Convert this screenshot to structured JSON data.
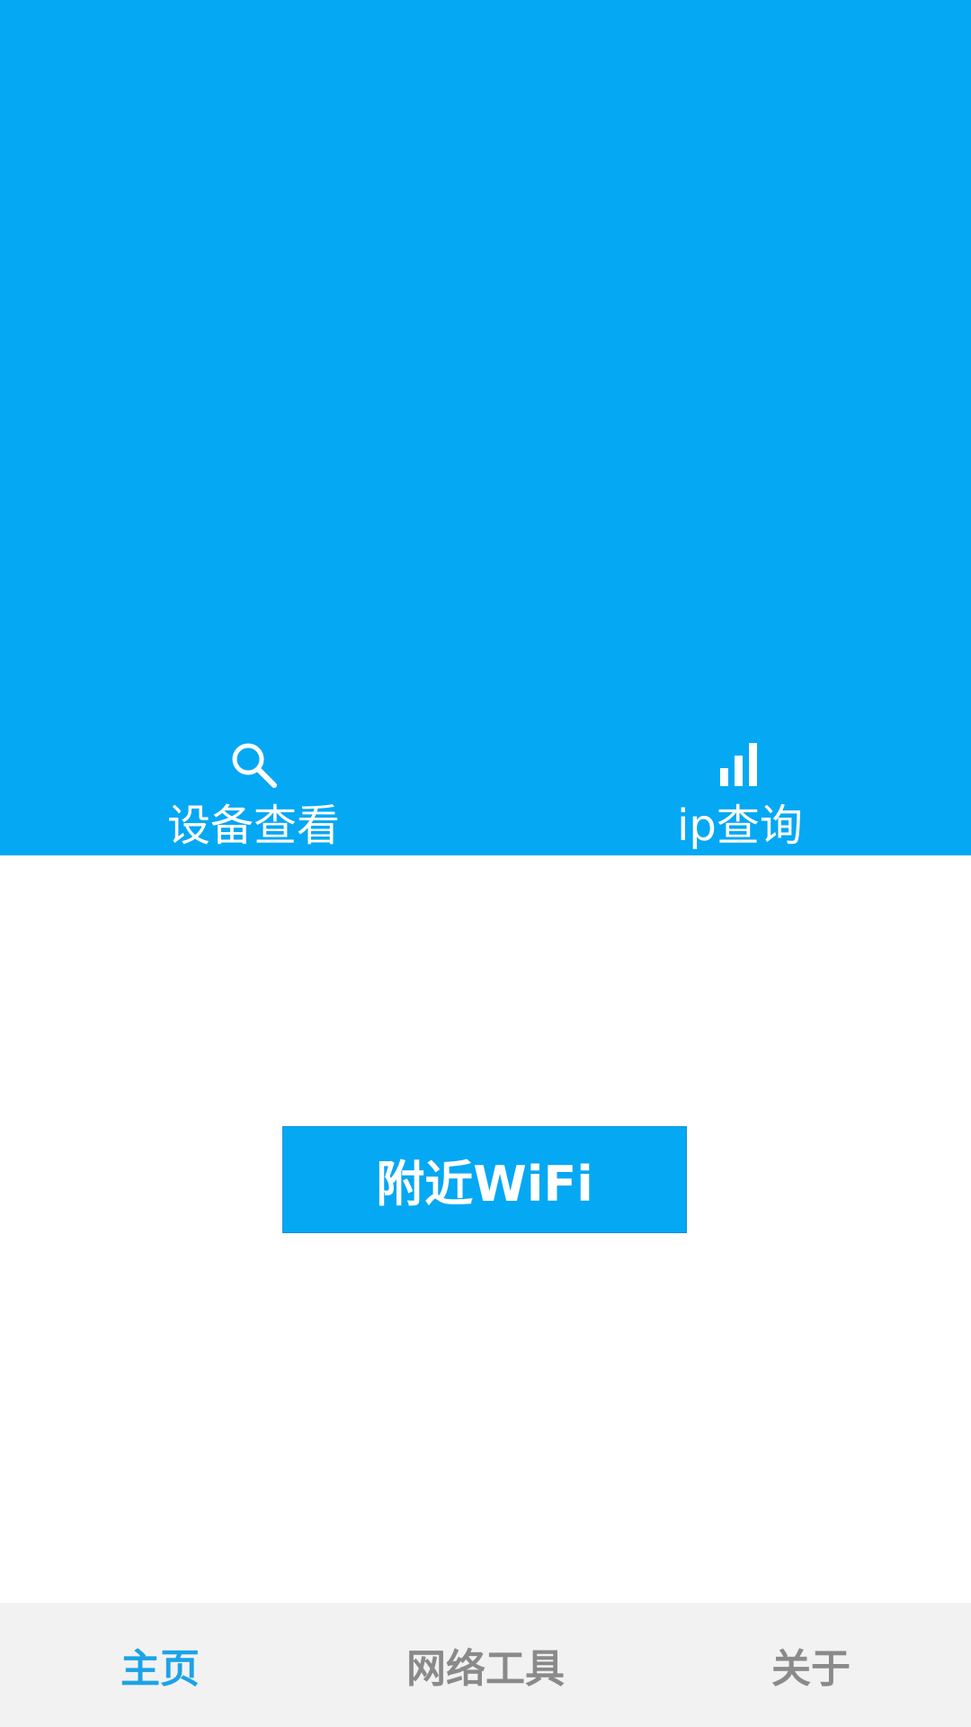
{
  "colors": {
    "primary": "#05a8f3",
    "active_tab": "#1ba3e8",
    "inactive_tab": "#8a8a8a",
    "bottom_bar_bg": "#f2f2f2"
  },
  "quick_actions": {
    "device_view": {
      "label": "设备查看",
      "icon": "search-icon"
    },
    "ip_query": {
      "label": "ip查询",
      "icon": "signal-bars-icon"
    }
  },
  "main": {
    "nearby_wifi_label": "附近WiFi"
  },
  "bottom_nav": {
    "items": [
      {
        "label": "主页",
        "active": true
      },
      {
        "label": "网络工具",
        "active": false
      },
      {
        "label": "关于",
        "active": false
      }
    ]
  }
}
